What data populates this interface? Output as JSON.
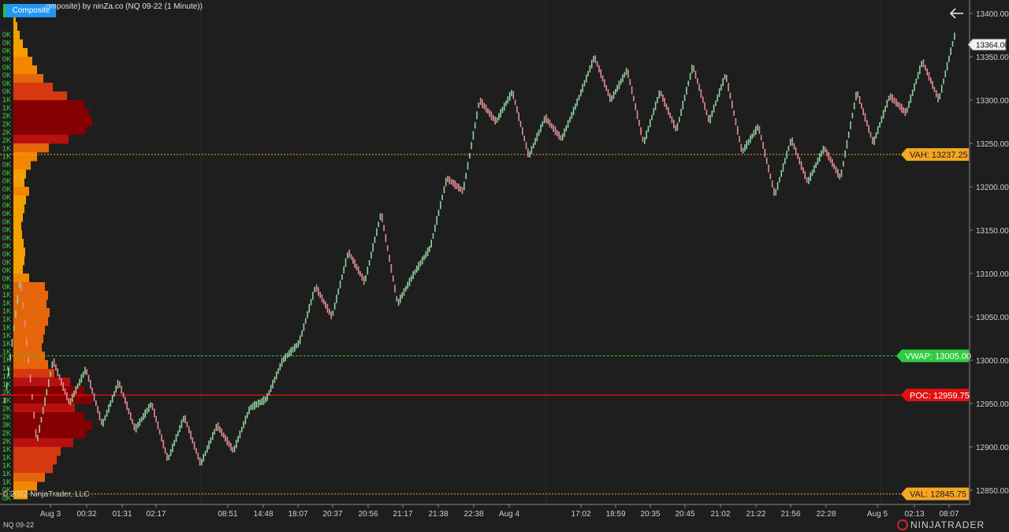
{
  "header": {
    "title": "omposite) by ninZa.co (NQ 09-22 (1 Minute))",
    "composite_button": "Composite"
  },
  "footer": {
    "instrument": "NQ 09-22",
    "copyright": "© 2022 NinjaTrader, LLC",
    "brand": "NINJATRADER"
  },
  "colors": {
    "background": "#1e1e1e",
    "up": "#8fd19e",
    "down": "#e58c96",
    "vah": "#f5a623",
    "val": "#f5a623",
    "vwap": "#2ecc40",
    "poc": "#e01010",
    "volume_label": "#3ddc3d"
  },
  "chart_data": {
    "type": "line",
    "title": "",
    "ylim": [
      12835,
      13410
    ],
    "y_ticks": [
      13400,
      13350,
      13300,
      13250,
      13200,
      13150,
      13100,
      13050,
      13000,
      12950,
      12900,
      12850
    ],
    "y_tick_labels": [
      "13400.00",
      "13350.00",
      "13300.00",
      "13250.00",
      "13200.00",
      "13150.00",
      "13100.00",
      "13050.00",
      "13000.00",
      "12950.00",
      "12900.00",
      "12850.00"
    ],
    "x_time_labels": [
      "Aug 3",
      "00:32",
      "01:31",
      "02:17",
      "08:51",
      "14:48",
      "18:07",
      "20:37",
      "20:56",
      "21:17",
      "21:38",
      "22:38",
      "Aug 4",
      "17:02",
      "18:59",
      "20:35",
      "20:45",
      "21:02",
      "21:22",
      "21:56",
      "22:28",
      "Aug 5",
      "02:13",
      "08:07"
    ],
    "price_path": [
      12945,
      13095,
      12905,
      13000,
      12950,
      12990,
      12925,
      12975,
      12920,
      12950,
      12885,
      12935,
      12880,
      12925,
      12895,
      12945,
      12955,
      13000,
      13020,
      13085,
      13050,
      13125,
      13090,
      13170,
      13065,
      13100,
      13130,
      13210,
      13195,
      13300,
      13275,
      13310,
      13235,
      13280,
      13255,
      13300,
      13350,
      13300,
      13335,
      13250,
      13310,
      13265,
      13340,
      13275,
      13330,
      13240,
      13270,
      13190,
      13255,
      13205,
      13245,
      13210,
      13310,
      13250,
      13305,
      13285,
      13345,
      13300,
      13378
    ],
    "series": [
      {
        "name": "VAH",
        "value": 13237.25,
        "label": "VAH: 13237.25"
      },
      {
        "name": "VWAP",
        "value": 13005.0,
        "label": "VWAP: 13005.00"
      },
      {
        "name": "POC",
        "value": 12959.75,
        "label": "POC: 12959.75"
      },
      {
        "name": "VAL",
        "value": 12845.75,
        "label": "VAL: 12845.75"
      }
    ],
    "current_price": {
      "value": 13364.0,
      "label": "13364.00"
    },
    "volume_profile": {
      "bins": [
        {
          "y": 13405,
          "v": 2
        },
        {
          "y": 13395,
          "v": 3
        },
        {
          "y": 13385,
          "v": 5
        },
        {
          "y": 13375,
          "v": 8
        },
        {
          "y": 13365,
          "v": 12
        },
        {
          "y": 13355,
          "v": 18
        },
        {
          "y": 13345,
          "v": 24
        },
        {
          "y": 13335,
          "v": 30
        },
        {
          "y": 13325,
          "v": 38
        },
        {
          "y": 13315,
          "v": 50
        },
        {
          "y": 13305,
          "v": 68
        },
        {
          "y": 13295,
          "v": 90
        },
        {
          "y": 13285,
          "v": 96
        },
        {
          "y": 13275,
          "v": 100
        },
        {
          "y": 13265,
          "v": 92
        },
        {
          "y": 13255,
          "v": 70
        },
        {
          "y": 13245,
          "v": 45
        },
        {
          "y": 13235,
          "v": 30
        },
        {
          "y": 13225,
          "v": 22
        },
        {
          "y": 13215,
          "v": 16
        },
        {
          "y": 13205,
          "v": 14
        },
        {
          "y": 13195,
          "v": 20
        },
        {
          "y": 13185,
          "v": 16
        },
        {
          "y": 13175,
          "v": 14
        },
        {
          "y": 13165,
          "v": 12
        },
        {
          "y": 13155,
          "v": 10
        },
        {
          "y": 13145,
          "v": 11
        },
        {
          "y": 13135,
          "v": 13
        },
        {
          "y": 13125,
          "v": 15
        },
        {
          "y": 13115,
          "v": 14
        },
        {
          "y": 13105,
          "v": 12
        },
        {
          "y": 13095,
          "v": 20
        },
        {
          "y": 13085,
          "v": 40
        },
        {
          "y": 13075,
          "v": 44
        },
        {
          "y": 13065,
          "v": 42
        },
        {
          "y": 13055,
          "v": 46
        },
        {
          "y": 13045,
          "v": 44
        },
        {
          "y": 13035,
          "v": 40
        },
        {
          "y": 13025,
          "v": 38
        },
        {
          "y": 13015,
          "v": 36
        },
        {
          "y": 13005,
          "v": 40
        },
        {
          "y": 12995,
          "v": 44
        },
        {
          "y": 12985,
          "v": 52
        },
        {
          "y": 12975,
          "v": 72
        },
        {
          "y": 12965,
          "v": 90
        },
        {
          "y": 12955,
          "v": 100
        },
        {
          "y": 12945,
          "v": 78
        },
        {
          "y": 12935,
          "v": 90
        },
        {
          "y": 12925,
          "v": 100
        },
        {
          "y": 12915,
          "v": 92
        },
        {
          "y": 12905,
          "v": 76
        },
        {
          "y": 12895,
          "v": 60
        },
        {
          "y": 12885,
          "v": 55
        },
        {
          "y": 12875,
          "v": 50
        },
        {
          "y": 12865,
          "v": 40
        },
        {
          "y": 12855,
          "v": 30
        },
        {
          "y": 12845,
          "v": 18
        }
      ],
      "labels": [
        "0K",
        "0K",
        "0K",
        "0K",
        "0K",
        "0K",
        "0K",
        "0K",
        "1K",
        "1K",
        "2K",
        "2K",
        "2K",
        "2K",
        "1K",
        "1K",
        "0K",
        "0K",
        "0K",
        "0K",
        "0K",
        "0K",
        "0K",
        "0K",
        "0K",
        "0K",
        "0K",
        "0K",
        "0K",
        "0K",
        "0K",
        "0K",
        "1K",
        "1K",
        "1K",
        "1K",
        "1K",
        "1K",
        "1K",
        "1K",
        "1K",
        "1K",
        "1K",
        "1K",
        "2K",
        "2K",
        "2K",
        "2K",
        "3K",
        "2K",
        "2K",
        "1K",
        "1K",
        "1K",
        "1K",
        "1K",
        "0K",
        "0K"
      ]
    }
  }
}
